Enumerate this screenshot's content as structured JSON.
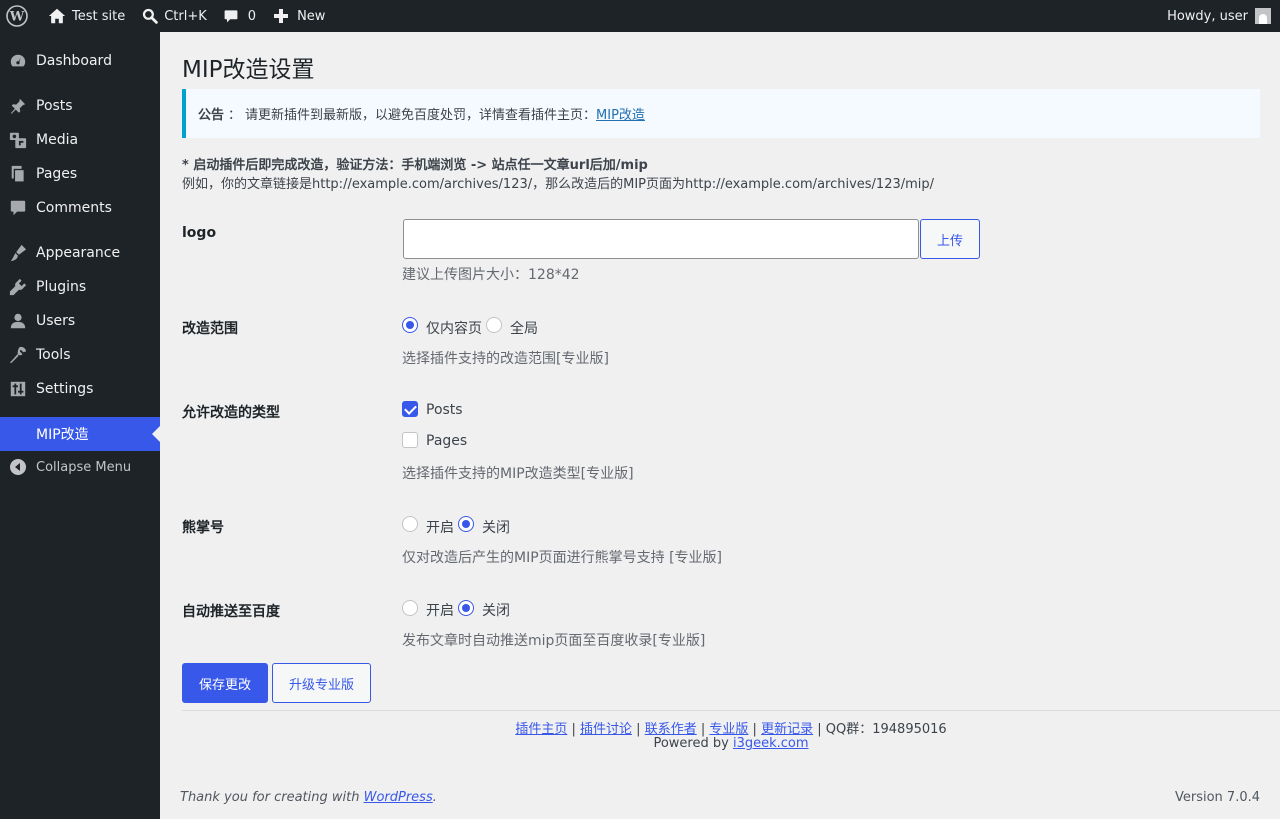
{
  "admin_bar": {
    "site_name": "Test site",
    "search_shortcut": "Ctrl+K",
    "comments_count": "0",
    "new_label": "New",
    "howdy": "Howdy, user"
  },
  "sidebar": {
    "items": [
      {
        "label": "Dashboard",
        "icon": "dashboard-icon"
      },
      {
        "label": "Posts",
        "icon": "pin-icon"
      },
      {
        "label": "Media",
        "icon": "media-icon"
      },
      {
        "label": "Pages",
        "icon": "pages-icon"
      },
      {
        "label": "Comments",
        "icon": "comment-icon"
      },
      {
        "label": "Appearance",
        "icon": "brush-icon"
      },
      {
        "label": "Plugins",
        "icon": "plugin-icon"
      },
      {
        "label": "Users",
        "icon": "user-icon"
      },
      {
        "label": "Tools",
        "icon": "wrench-icon"
      },
      {
        "label": "Settings",
        "icon": "settings-icon"
      },
      {
        "label": "MIP改造",
        "icon": "",
        "current": true
      }
    ],
    "collapse_label": "Collapse Menu"
  },
  "page": {
    "title": "MIP改造设置",
    "notice": {
      "label": "公告",
      "colon": "：",
      "text": "请更新插件到最新版，以避免百度处罚，详情查看插件主页：",
      "link": "MIP改造"
    },
    "intro_bold": "* 启动插件后即完成改造，验证方法：手机端浏览 -> 站点任一文章url后加/mip",
    "intro_example": "例如，你的文章链接是http://example.com/archives/123/，那么改造后的MIP页面为http://example.com/archives/123/mip/"
  },
  "form": {
    "logo": {
      "label": "logo",
      "value": "",
      "upload_button": "上传",
      "description": "建议上传图片大小：128*42"
    },
    "scope": {
      "label": "改造范围",
      "options": [
        "仅内容页",
        "全局"
      ],
      "selected": "仅内容页",
      "description": "选择插件支持的改造范围[专业版]"
    },
    "types": {
      "label": "允许改造的类型",
      "options": [
        {
          "label": "Posts",
          "checked": true
        },
        {
          "label": "Pages",
          "checked": false
        }
      ],
      "description": "选择插件支持的MIP改造类型[专业版]"
    },
    "xiongzhang": {
      "label": "熊掌号",
      "options": [
        "开启",
        "关闭"
      ],
      "selected": "关闭",
      "description": "仅对改造后产生的MIP页面进行熊掌号支持 [专业版]"
    },
    "autopush": {
      "label": "自动推送至百度",
      "options": [
        "开启",
        "关闭"
      ],
      "selected": "关闭",
      "description": "发布文章时自动推送mip页面至百度收录[专业版]"
    },
    "save_button": "保存更改",
    "upgrade_button": "升级专业版"
  },
  "plugin_footer": {
    "links": [
      "插件主页",
      "插件讨论",
      "联系作者",
      "专业版",
      "更新记录"
    ],
    "separator": "|",
    "qq": "QQ群：194895016",
    "powered_prefix": "Powered by",
    "powered_link": "i3geek.com"
  },
  "wp_footer": {
    "thanks_prefix": "Thank you for creating with",
    "thanks_link": "WordPress",
    "thanks_suffix": ".",
    "version": "Version 7.0.4"
  },
  "colors": {
    "admin_dark": "#1d2327",
    "accent": "#3858e9",
    "notice_border": "#00a0d2",
    "background": "#f0f0f1"
  }
}
